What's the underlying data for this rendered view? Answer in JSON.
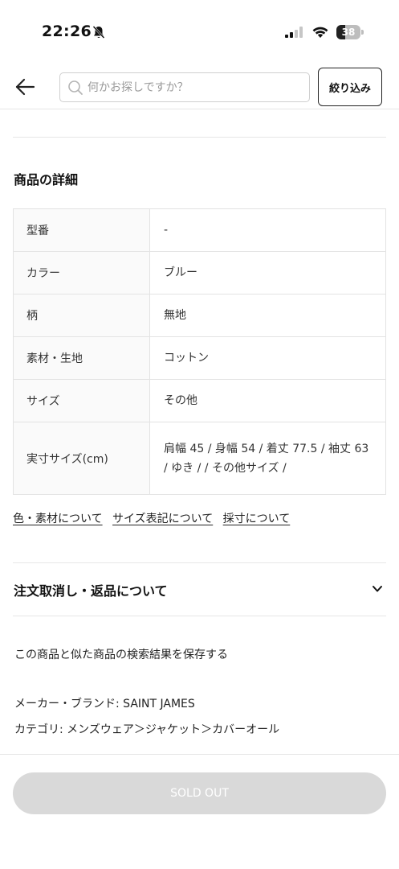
{
  "status_bar": {
    "time": "22:26",
    "battery_level": "38",
    "battery_fraction": 0.38
  },
  "header": {
    "search_placeholder": "何かお探しですか？",
    "filter_label": "絞り込み"
  },
  "details": {
    "title": "商品の詳細",
    "rows": [
      {
        "label": "型番",
        "value": "-"
      },
      {
        "label": "カラー",
        "value": "ブルー"
      },
      {
        "label": "柄",
        "value": "無地"
      },
      {
        "label": "素材・生地",
        "value": "コットン"
      },
      {
        "label": "サイズ",
        "value": "その他"
      },
      {
        "label": "実寸サイズ(cm)",
        "value": "肩幅 45 / 身幅 54 / 着丈 77.5 / 袖丈 63 / ゆき / / その他サイズ /"
      }
    ]
  },
  "links": [
    "色・素材について",
    "サイズ表記について",
    "採寸について"
  ],
  "accordion": {
    "title": "注文取消し・返品について"
  },
  "save_search": "この商品と似た商品の検索結果を保存する",
  "maker": "メーカー・ブランド: SAINT JAMES",
  "category": "カテゴリ: メンズウェア＞ジャケット＞カバーオール",
  "bottom": {
    "button_label": "SOLD OUT"
  },
  "icons": {
    "bell": "bell-slash-icon",
    "signal": "signal-icon",
    "wifi": "wifi-icon",
    "back": "back-arrow-icon",
    "search": "search-icon",
    "chevron": "chevron-down-icon"
  }
}
